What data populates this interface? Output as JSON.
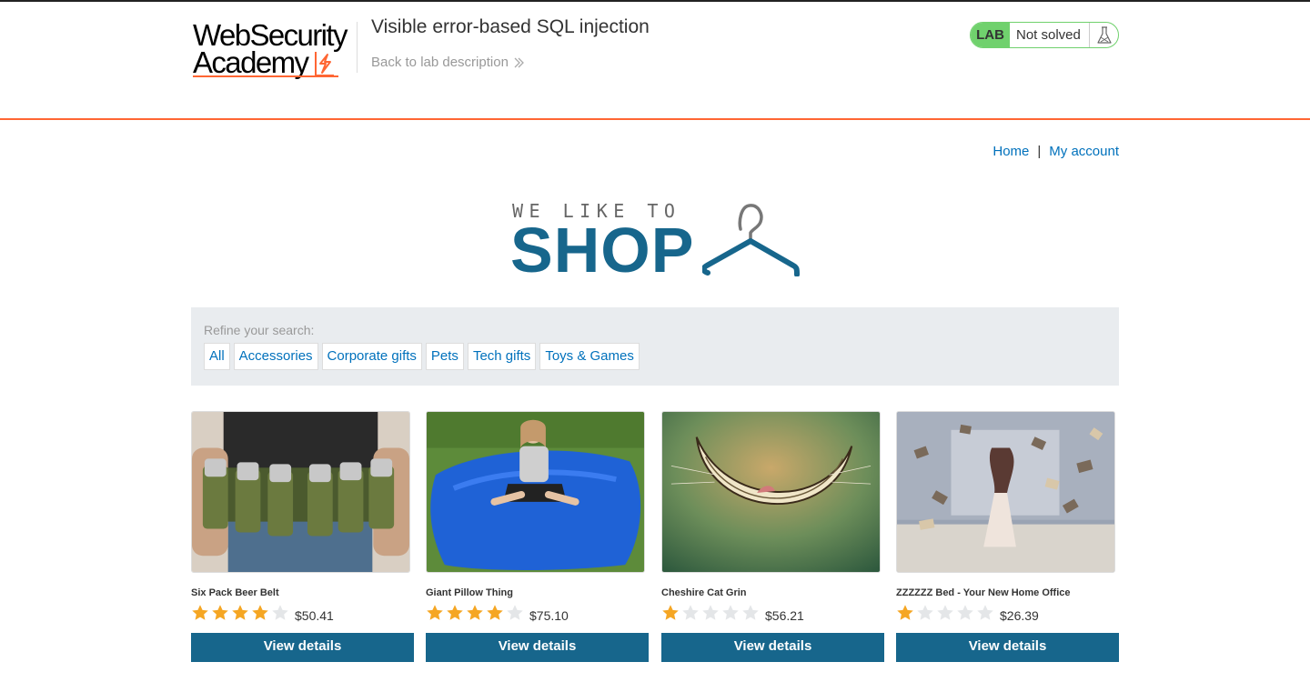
{
  "academy": {
    "logo_line1": "WebSecurity",
    "logo_line2": "Academy",
    "lab_title": "Visible error-based SQL injection",
    "back_link": "Back to lab description",
    "lab_badge": "LAB",
    "lab_status": "Not solved",
    "accent_color": "#ff6633",
    "solved_color": "#70d16d"
  },
  "nav": {
    "home": "Home",
    "separator": "|",
    "account": "My account"
  },
  "shop_logo": {
    "small_text": "WE LIKE TO",
    "big_text": "SHOP",
    "color": "#17668c"
  },
  "filter": {
    "label": "Refine your search:",
    "items": [
      "All",
      "Accessories",
      "Corporate gifts",
      "Pets",
      "Tech gifts",
      "Toys & Games"
    ]
  },
  "products": [
    {
      "name": "Six Pack Beer Belt",
      "rating": 4,
      "price": "$50.41",
      "button": "View details",
      "image": "beer-belt-photo"
    },
    {
      "name": "Giant Pillow Thing",
      "rating": 4,
      "price": "$75.10",
      "button": "View details",
      "image": "blue-pillow-photo"
    },
    {
      "name": "Cheshire Cat Grin",
      "rating": 1,
      "price": "$56.21",
      "button": "View details",
      "image": "cat-grin-photo"
    },
    {
      "name": "ZZZZZZ Bed - Your New Home Office",
      "rating": 1,
      "price": "$26.39",
      "button": "View details",
      "image": "flying-books-photo"
    }
  ]
}
